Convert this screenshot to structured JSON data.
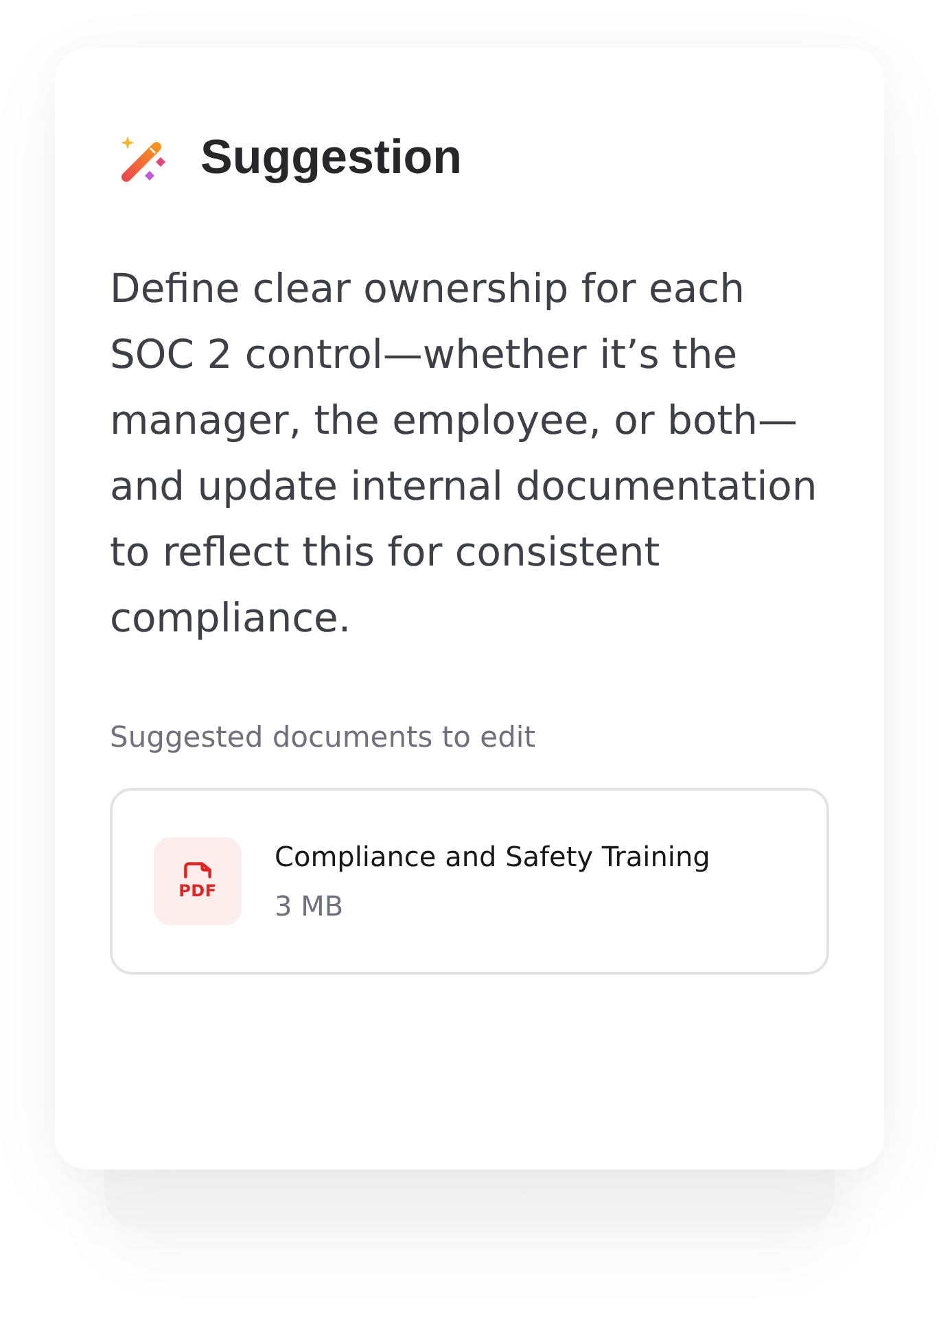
{
  "suggestion": {
    "title": "Suggestion",
    "body": "Define clear ownership for each SOC 2 control—whether it’s the manager, the employee, or both—and update internal documentation to reflect this for consistent compliance.",
    "documents_label": "Suggested documents to edit",
    "documents": [
      {
        "type_label": "PDF",
        "name": "Compliance and Safety Training",
        "size": "3 MB"
      }
    ]
  }
}
